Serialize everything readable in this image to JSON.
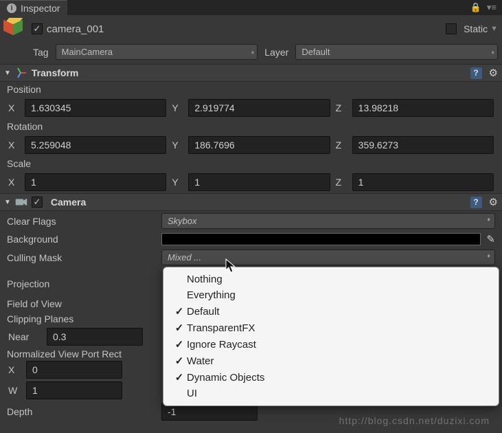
{
  "tab": {
    "title": "Inspector"
  },
  "object": {
    "enabled_check": "✓",
    "name": "camera_001",
    "static_label": "Static",
    "static_check": ""
  },
  "tagrow": {
    "tag_label": "Tag",
    "tag_value": "MainCamera",
    "layer_label": "Layer",
    "layer_value": "Default"
  },
  "transform": {
    "title": "Transform",
    "position_label": "Position",
    "rotation_label": "Rotation",
    "scale_label": "Scale",
    "axis_x": "X",
    "axis_y": "Y",
    "axis_z": "Z",
    "pos": {
      "x": "1.630345",
      "y": "2.919774",
      "z": "13.98218"
    },
    "rot": {
      "x": "5.259048",
      "y": "186.7696",
      "z": "359.6273"
    },
    "scl": {
      "x": "1",
      "y": "1",
      "z": "1"
    }
  },
  "camera": {
    "title": "Camera",
    "enabled_check": "✓",
    "clear_flags_label": "Clear Flags",
    "clear_flags_value": "Skybox",
    "background_label": "Background",
    "culling_mask_label": "Culling Mask",
    "culling_mask_value": "Mixed ...",
    "projection_label": "Projection",
    "fov_label": "Field of View",
    "clipping_label": "Clipping Planes",
    "near_label": "Near",
    "near_value": "0.3",
    "nvpr_label": "Normalized View Port Rect",
    "nvpr_x_label": "X",
    "nvpr_x": "0",
    "nvpr_w_label": "W",
    "nvpr_w": "1",
    "depth_label": "Depth",
    "depth_value": "-1"
  },
  "popup": {
    "items": [
      {
        "checked": "",
        "label": "Nothing"
      },
      {
        "checked": "",
        "label": "Everything"
      },
      {
        "checked": "✓",
        "label": "Default"
      },
      {
        "checked": "✓",
        "label": "TransparentFX"
      },
      {
        "checked": "✓",
        "label": "Ignore Raycast"
      },
      {
        "checked": "✓",
        "label": "Water"
      },
      {
        "checked": "✓",
        "label": "Dynamic Objects"
      },
      {
        "checked": "",
        "label": "UI"
      }
    ]
  },
  "watermark": "http://blog.csdn.net/duzixi.com"
}
